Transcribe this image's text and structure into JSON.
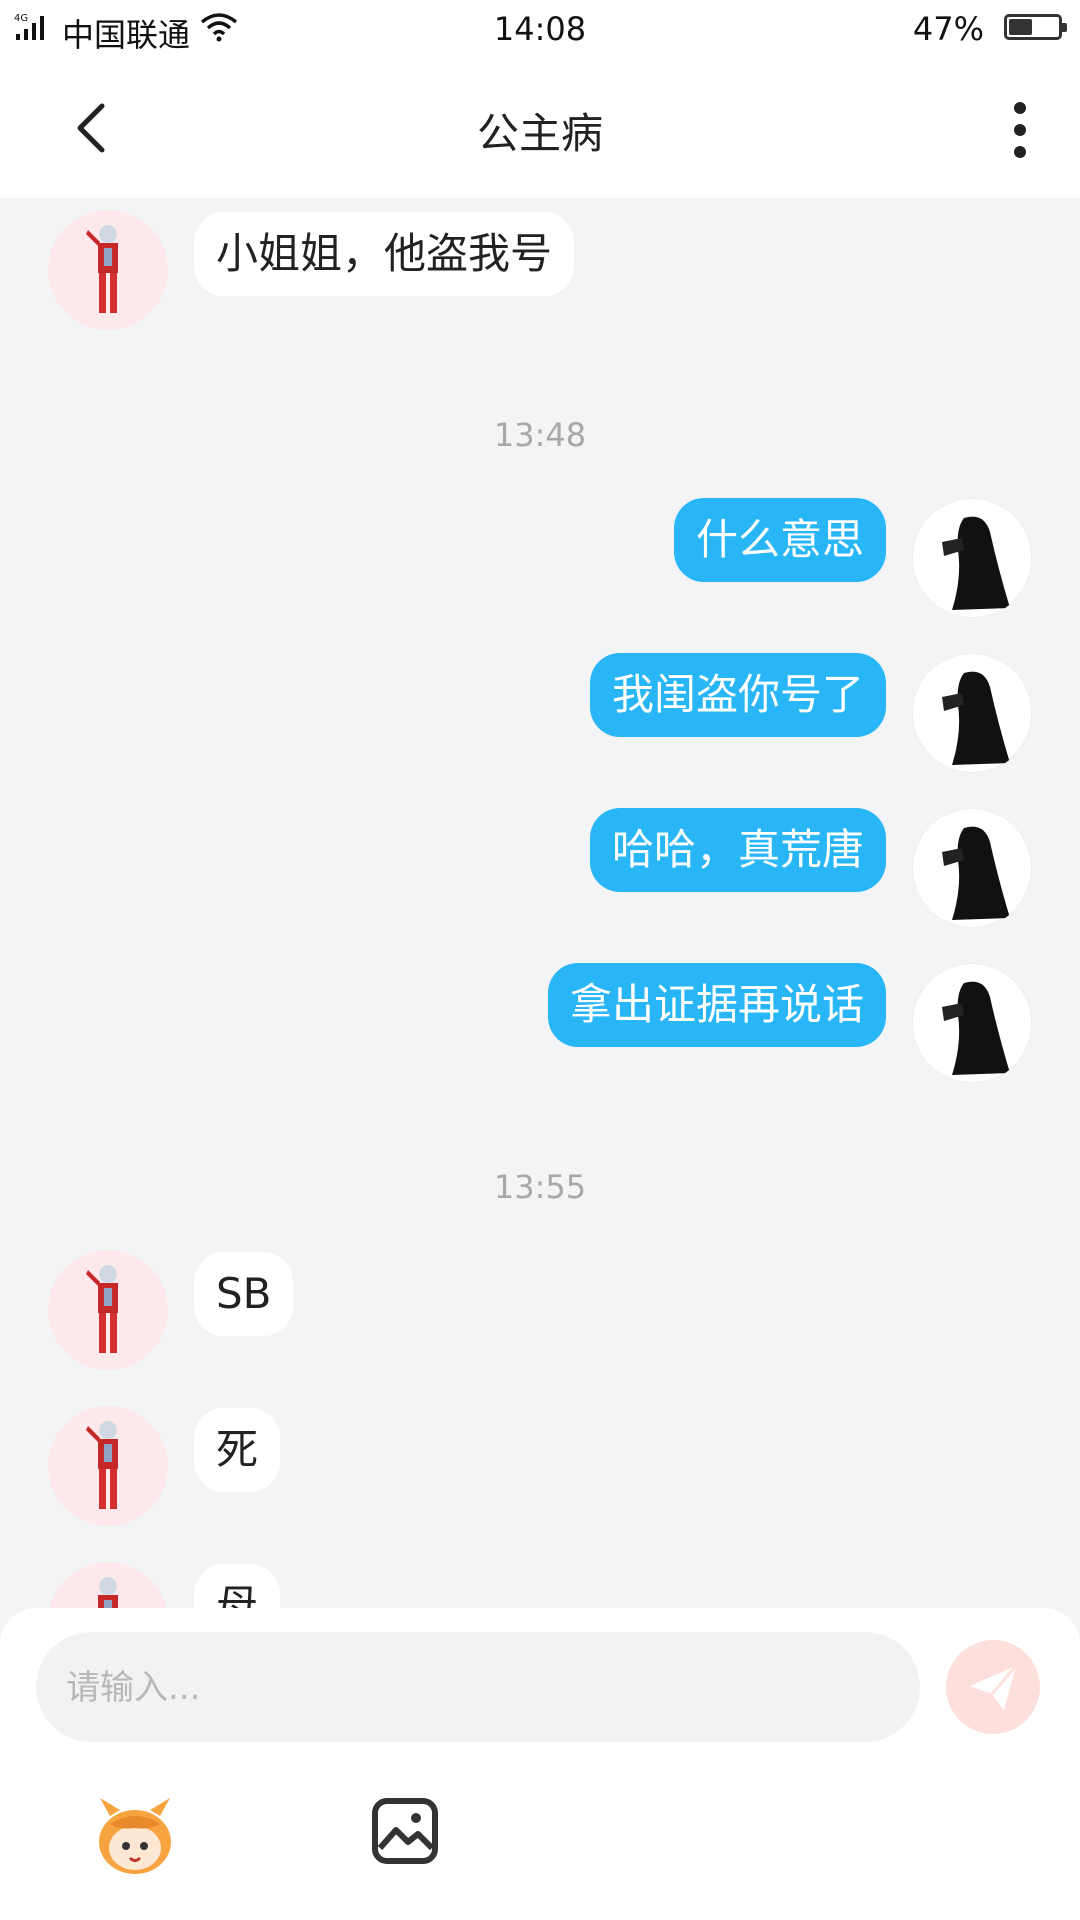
{
  "status_bar": {
    "network": "4G",
    "carrier": "中国联通",
    "time": "14:08",
    "battery_percent_label": "47%",
    "battery_level": 0.47
  },
  "header": {
    "title": "公主病",
    "back_icon": "chevron-left-icon",
    "more_icon": "more-vertical-icon"
  },
  "messages": [
    {
      "side": "left",
      "text": "小姐姐，他盗我号"
    },
    {
      "type": "time",
      "text": "13:48"
    },
    {
      "side": "right",
      "text": "什么意思"
    },
    {
      "side": "right",
      "text": "我闺盗你号了"
    },
    {
      "side": "right",
      "text": "哈哈，真荒唐"
    },
    {
      "side": "right",
      "text": "拿出证据再说话"
    },
    {
      "type": "time",
      "text": "13:55"
    },
    {
      "side": "left",
      "text": "SB"
    },
    {
      "side": "left",
      "text": "死"
    },
    {
      "side": "left",
      "text": "母"
    }
  ],
  "input": {
    "placeholder": "请输入...",
    "value": "",
    "send_icon": "paper-plane-icon"
  },
  "toolbar": {
    "emoji_icon": "mascot-emoji-icon",
    "image_icon": "image-icon"
  },
  "colors": {
    "outgoing_bubble": "#29b6f6",
    "incoming_bubble": "#ffffff",
    "chat_background": "#f3f4f6",
    "send_button": "#fde0dc"
  }
}
